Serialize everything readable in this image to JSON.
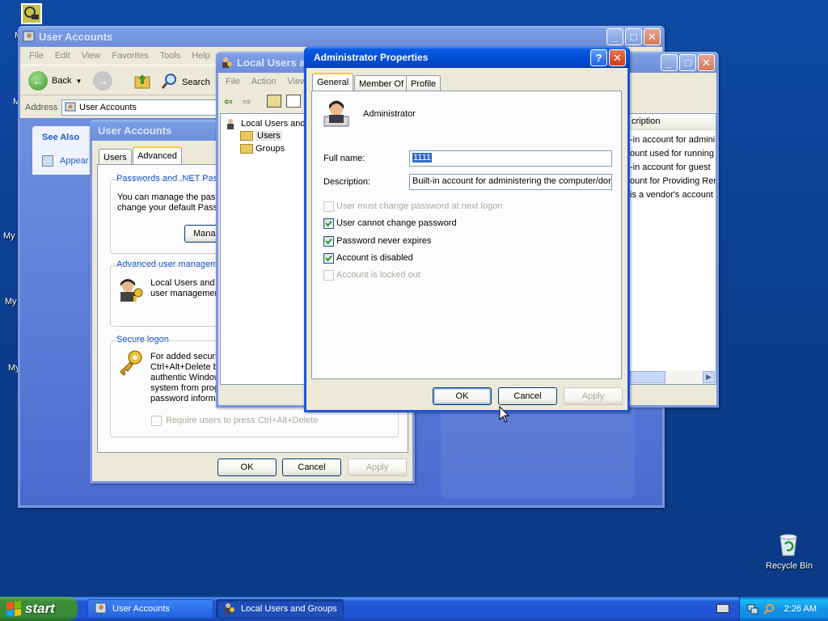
{
  "desktop": {
    "labels": [
      "M",
      "My",
      "My I",
      "My",
      "My"
    ],
    "recycle_bin": "Recycle Bin"
  },
  "user_accounts_window": {
    "title": "User Accounts",
    "menu": [
      "File",
      "Edit",
      "View",
      "Favorites",
      "Tools",
      "Help"
    ],
    "toolbar": {
      "back": "Back",
      "search": "Search"
    },
    "address_label": "Address",
    "address_value": "User Accounts",
    "see_also": "See Also",
    "appearance_link": "Appear"
  },
  "user_accounts_dialog": {
    "title": "User Accounts",
    "tabs": [
      "Users",
      "Advanced"
    ],
    "passwords_group": "Passwords and .NET Passp",
    "passwords_text_1": "You can manage the pass",
    "passwords_text_2": "change your default Passp",
    "manage_button": "Manag",
    "advanced_group": "Advanced user manageme",
    "advanced_text_1": "Local Users and G",
    "advanced_text_2": "user managemen",
    "secure_group": "Secure logon",
    "secure_text": [
      "For added securit",
      "Ctrl+Alt+Delete b",
      "authentic Window",
      "system from prog",
      "password informa"
    ],
    "require_cad": "Require users to press Ctrl+Alt+Delete",
    "ok": "OK",
    "cancel": "Cancel",
    "apply": "Apply"
  },
  "lusrmgr_window": {
    "title": "Local Users a",
    "menu": [
      "File",
      "Action",
      "View"
    ],
    "tree_root": "Local Users and G",
    "tree_users": "Users",
    "tree_groups": "Groups",
    "col_description": "cription",
    "descriptions": [
      "-in account for admini",
      "ount used for running",
      "-in account for guest",
      "ount for Providing Rem",
      "is a vendor's account"
    ]
  },
  "admin_properties": {
    "title": "Administrator Properties",
    "help_btn": "?",
    "tabs": [
      "General",
      "Member Of",
      "Profile"
    ],
    "username": "Administrator",
    "full_name_label": "Full name:",
    "full_name_value": "1111",
    "description_label": "Description:",
    "description_value": "Built-in account for administering the computer/doma",
    "checkboxes": [
      {
        "label": "User must change password at next logon",
        "checked": false,
        "enabled": false
      },
      {
        "label": "User cannot change password",
        "checked": true,
        "enabled": true
      },
      {
        "label": "Password never expires",
        "checked": true,
        "enabled": true
      },
      {
        "label": "Account is disabled",
        "checked": true,
        "enabled": true
      },
      {
        "label": "Account is locked out",
        "checked": false,
        "enabled": false
      }
    ],
    "ok": "OK",
    "cancel": "Cancel",
    "apply": "Apply"
  },
  "taskbar": {
    "start": "start",
    "items": [
      "User Accounts",
      "Local Users and Groups"
    ],
    "clock": "2:26 AM"
  }
}
